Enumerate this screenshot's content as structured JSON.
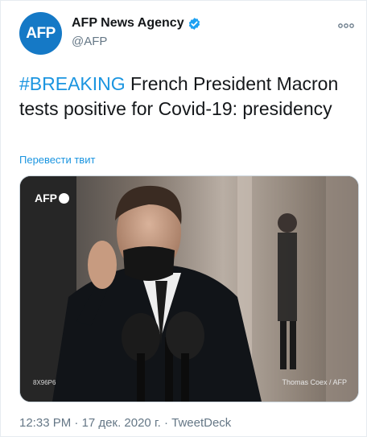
{
  "author": {
    "avatar_text": "AFP",
    "display_name": "AFP News Agency",
    "handle": "@AFP",
    "verified": true,
    "avatar_color": "#1579c6"
  },
  "tweet": {
    "hashtag": "#BREAKING",
    "text": " French President Macron tests positive for Covid-19: presidency",
    "translate_link": "Перевести твит",
    "link_color": "#1b95e0"
  },
  "photo": {
    "logo_text": "AFP",
    "image_id": "8X96P6",
    "credit": "Thomas Coex / AFP"
  },
  "meta": {
    "time": "12:33 PM",
    "separator": "·",
    "date": "17 дек. 2020 г.",
    "source": "TweetDeck"
  },
  "icons": {
    "verified": "verified-badge-icon",
    "more": "more-options-icon"
  }
}
